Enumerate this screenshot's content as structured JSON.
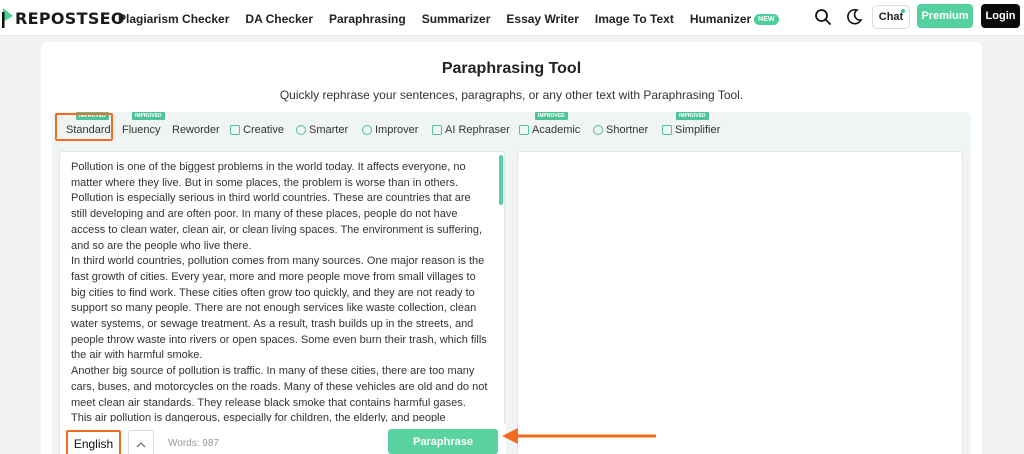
{
  "brand": {
    "logo_text": "REPOSTSEO",
    "accent": "#55d19f",
    "highlight": "#ef6c20"
  },
  "nav": {
    "links": [
      "Plagiarism Checker",
      "DA Checker",
      "Paraphrasing",
      "Summarizer",
      "Essay Writer",
      "Image To Text"
    ],
    "humanizer": "Humanizer",
    "new_badge": "NEW",
    "search_icon": "search-icon",
    "theme_icon": "moon-icon",
    "chat": "Chat",
    "premium": "Premium",
    "login": "Login"
  },
  "page": {
    "title": "Paraphrasing Tool",
    "subtitle": "Quickly rephrase your sentences, paragraphs, or any other text with Paraphrasing Tool."
  },
  "modes": {
    "items": [
      "Standard",
      "Fluency",
      "Reworder",
      "Creative",
      "Smarter",
      "Improver",
      "AI Rephraser",
      "Academic",
      "Shortner",
      "Simplifier"
    ],
    "badge": "IMPROVED",
    "selected": "Standard"
  },
  "editor": {
    "paragraphs": [
      "Pollution is one of the biggest problems in the world today. It affects everyone, no matter where they live. But in some places, the problem is worse than in others. Pollution is especially serious in third world countries. These are countries that are still developing and are often poor. In many of these places, people do not have access to clean water, clean air, or clean living spaces. The environment is suffering, and so are the people who live there.",
      "In third world countries, pollution comes from many sources. One major reason is the fast growth of cities. Every year, more and more people move from small villages to big cities to find work. These cities often grow too quickly, and they are not ready to support so many people. There are not enough services like waste collection, clean water systems, or sewage treatment. As a result, trash builds up in the streets, and people throw waste into rivers or open spaces. Some even burn their trash, which fills the air with harmful smoke.",
      "Another big source of pollution is traffic. In many of these cities, there are too many cars, buses, and motorcycles on the roads. Many of these vehicles are old and do not meet clean air standards. They release black smoke that contains harmful gases. This air pollution is dangerous, especially for children, the elderly, and people"
    ],
    "language": "English",
    "words_label": "Words: 987",
    "paraphrase_button": "Paraphrase"
  }
}
